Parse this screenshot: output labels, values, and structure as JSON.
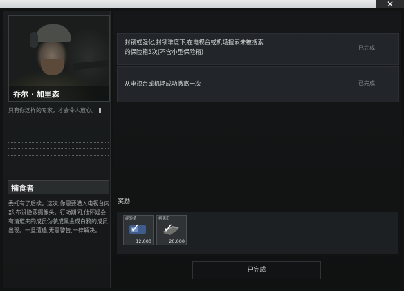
{
  "window": {
    "close_symbol": "✕"
  },
  "trader": {
    "name": "乔尔 · 加里森",
    "quote": "只有你这样的专家，才会令人放心。"
  },
  "mission": {
    "title": "捕食者",
    "description": "委托有了后续。这次,你需要潜入电视台内部,布设隐蔽摄像头。行动期间,他怀疑会有清道夫的成员伪装成黑金或白鸦的成员出现。一旦遭遇,无需警告,一律解决。"
  },
  "objectives": [
    {
      "text_line1": "封锁或强化,封锁难度下,在电视台或机场搜索未被搜索",
      "text_line2": "的保险箱5次(不含小型保险箱)",
      "status": "已完成"
    },
    {
      "text_line1": "从电视台或机场成功撤离一次",
      "text_line2": "",
      "status": "已完成"
    }
  ],
  "rewards": {
    "label": "奖励",
    "items": [
      {
        "label": "经验值",
        "amount": "12,000",
        "icon": "experience-icon",
        "claimed": true
      },
      {
        "label": "柯恩币",
        "amount": "20,000",
        "icon": "koen-coin-icon",
        "claimed": true
      }
    ]
  },
  "complete_button": "已完成",
  "colors": {
    "accent_text": "#d5d8d8",
    "status_text": "#7f8585",
    "panel": "#22262a"
  }
}
